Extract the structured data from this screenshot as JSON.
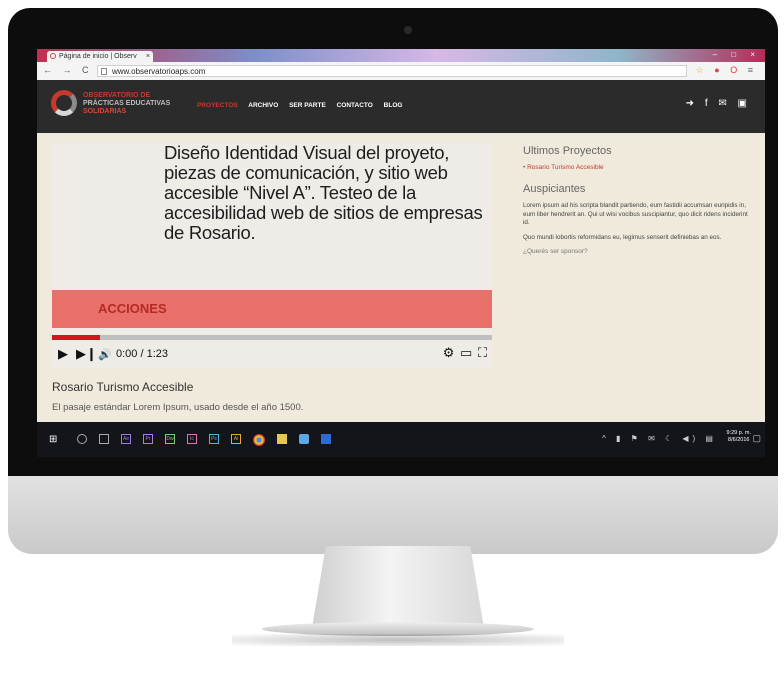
{
  "browser": {
    "tab_title": "Página de inicio | Observ",
    "tab_close": "×",
    "window_buttons": "– □ ×",
    "nav_icons": "← → C ⌂",
    "url": "www.observatorioaps.com",
    "extensions": {
      "star": "☆",
      "adblock": "●",
      "opera": "O",
      "menu": "≡"
    }
  },
  "site": {
    "logo_lines": [
      "OBSERVATORIO DE",
      "PRÁCTICAS EDUCATIVAS",
      "SOLIDARIAS"
    ],
    "menu": [
      "PROYECTOS",
      "ARCHIVO",
      "SER PARTE",
      "CONTACTO",
      "BLOG"
    ],
    "social_icons": [
      "sign-in-icon",
      "facebook-icon",
      "twitter-icon",
      "youtube-icon"
    ],
    "social_glyphs": "➜ f ✉ ▣"
  },
  "video": {
    "headline": "Diseño Identidad Visual del proyeto, piezas de comunicación, y sitio web accesible “Nivel A”. Testeo de la accesibilidad web de sitios de empresas de Rosario.",
    "banner": "ACCIONES",
    "play_glyph": "▶",
    "next_glyph": "▶❙",
    "volume_glyph": "🔊",
    "time": "0:00 / 1:23",
    "progress": 0.11,
    "settings_glyph": "⚙",
    "theater_glyph": "▭",
    "fullscreen_glyph": "⛶",
    "title": "Rosario Turismo Accesible",
    "description": "El pasaje estándar Lorem Ipsum, usado desde el año 1500."
  },
  "sidebar": {
    "recent_heading": "Ultimos Proyectos",
    "recent_link": "• Rosario Turismo Accesible",
    "sponsors_heading": "Auspiciantes",
    "paragraph1": "Lorem ipsum ad his scripta blandit partiendo, eum fastidii accumsan euripidis in, eum liber hendrerit an. Qui ut wisi vocibus suscipiantur, quo dicit ridens inciderint id.",
    "paragraph2": "Quo mundi lobortis reformidans eu, legimus senserit definiebas an eos.",
    "sponsor_question": "¿Querés ser sponsor?"
  },
  "taskbar": {
    "start_glyph": "⊞",
    "apps": [
      "Ae",
      "Pr",
      "Dw",
      "Ic",
      "Ps",
      "Ai"
    ],
    "tray_glyphs": "^ ▮ ⚑ ✉ ☾ ◀) ▤",
    "time": "9:29 p. m.",
    "date": "8/6/2016",
    "notifications_glyph": "▢"
  },
  "colors": {
    "accent_red": "#c63a2e",
    "banner_red": "#ea716b",
    "progress_red": "#d2161b",
    "page_bg": "#efeadb",
    "header_bg": "#2b2b2b"
  }
}
